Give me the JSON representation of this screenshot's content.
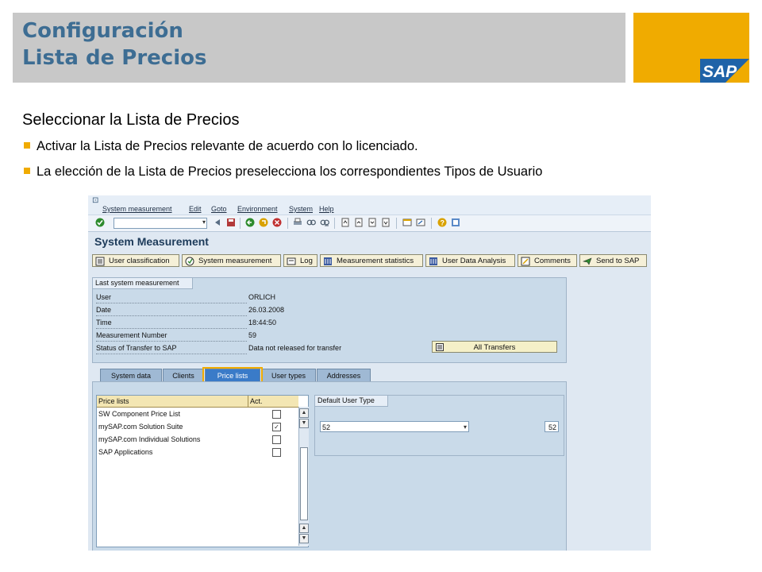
{
  "slide": {
    "title_line1": "Configuración",
    "title_line2": "Lista de Precios",
    "logo_text": "SAP",
    "subtitle": "Seleccionar la Lista de Precios",
    "bullets": [
      "Activar la Lista de Precios relevante de acuerdo con lo licenciado.",
      "La elección de la Lista de Precios preselecciona los correspondientes Tipos de Usuario"
    ],
    "colors": {
      "title_bar": "#c8c8c8",
      "title_text": "#3d6d93",
      "brand_gold": "#f0ab00"
    }
  },
  "sap_window": {
    "menu": [
      "System measurement",
      "Edit",
      "Goto",
      "Environment",
      "System",
      "Help"
    ],
    "screen_title": "System Measurement",
    "app_toolbar": [
      {
        "label": "User classification",
        "icon": "list-icon"
      },
      {
        "label": "System measurement",
        "icon": "execute-icon"
      },
      {
        "label": "Log",
        "icon": "log-icon"
      },
      {
        "label": "Measurement statistics",
        "icon": "statistics-icon"
      },
      {
        "label": "User Data Analysis",
        "icon": "analysis-icon"
      },
      {
        "label": "Comments",
        "icon": "comments-icon"
      },
      {
        "label": "Send to SAP",
        "icon": "send-icon"
      }
    ],
    "last_measurement": {
      "group_title": "Last system measurement",
      "fields": [
        {
          "label": "User",
          "value": "ORLICH"
        },
        {
          "label": "Date",
          "value": "26.03.2008"
        },
        {
          "label": "Time",
          "value": "18:44:50"
        },
        {
          "label": "Measurement Number",
          "value": "59"
        },
        {
          "label": "Status of Transfer to SAP",
          "value": "Data not released for transfer"
        }
      ],
      "all_transfers_label": "All Transfers"
    },
    "tabs": [
      {
        "label": "System data",
        "active": false
      },
      {
        "label": "Clients",
        "active": false
      },
      {
        "label": "Price lists",
        "active": true
      },
      {
        "label": "User types",
        "active": false
      },
      {
        "label": "Addresses",
        "active": false
      }
    ],
    "price_lists": {
      "col_name": "Price lists",
      "col_act": "Act.",
      "rows": [
        {
          "name": "SW Component Price List",
          "active": false
        },
        {
          "name": "mySAP.com Solution Suite",
          "active": true
        },
        {
          "name": "mySAP.com Individual Solutions",
          "active": false
        },
        {
          "name": "SAP Applications",
          "active": false
        }
      ]
    },
    "default_user_type": {
      "group_title": "Default User Type",
      "value": "52",
      "code": "52"
    }
  }
}
